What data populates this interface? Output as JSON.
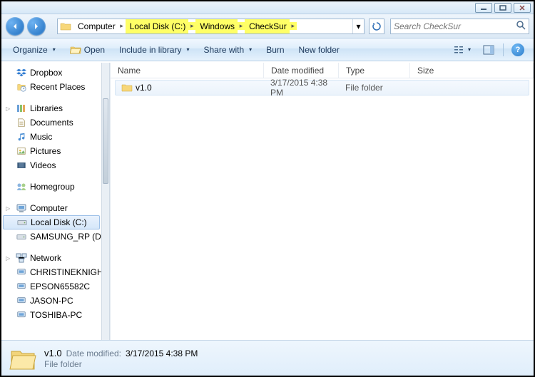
{
  "breadcrumb": {
    "items": [
      {
        "label": "Computer",
        "highlight": false
      },
      {
        "label": "Local Disk (C:)",
        "highlight": true
      },
      {
        "label": "Windows",
        "highlight": true
      },
      {
        "label": "CheckSur",
        "highlight": true
      }
    ]
  },
  "search": {
    "placeholder": "Search CheckSur"
  },
  "toolbar": {
    "organize": "Organize",
    "open": "Open",
    "include": "Include in library",
    "share": "Share with",
    "burn": "Burn",
    "newfolder": "New folder"
  },
  "sidebar": {
    "dropbox": "Dropbox",
    "recent": "Recent Places",
    "libraries": "Libraries",
    "documents": "Documents",
    "music": "Music",
    "pictures": "Pictures",
    "videos": "Videos",
    "homegroup": "Homegroup",
    "computer": "Computer",
    "localdisk": "Local Disk (C:)",
    "samsung": "SAMSUNG_RP (D:)",
    "network": "Network",
    "net1": "CHRISTINEKNIGHT",
    "net2": "EPSON65582C",
    "net3": "JASON-PC",
    "net4": "TOSHIBA-PC"
  },
  "columns": {
    "name": "Name",
    "date": "Date modified",
    "type": "Type",
    "size": "Size"
  },
  "files": [
    {
      "name": "v1.0",
      "date": "3/17/2015 4:38 PM",
      "type": "File folder",
      "size": ""
    }
  ],
  "details": {
    "name": "v1.0",
    "subtype": "File folder",
    "date_label": "Date modified:",
    "date": "3/17/2015 4:38 PM"
  }
}
